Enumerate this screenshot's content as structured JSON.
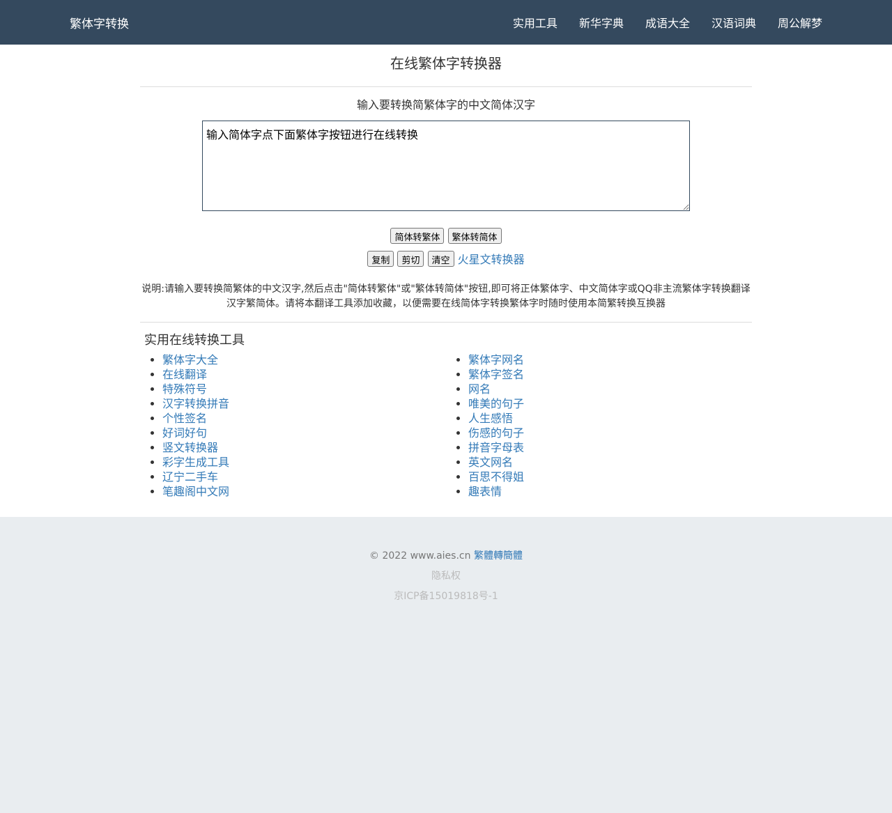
{
  "navbar": {
    "brand": "繁体字转换",
    "items": [
      "实用工具",
      "新华字典",
      "成语大全",
      "汉语词典",
      "周公解梦"
    ]
  },
  "main": {
    "title": "在线繁体字转换器",
    "subtitle": "输入要转换简繁体字的中文简体汉字",
    "textarea_value": "输入简体字点下面繁体字按钮进行在线转换",
    "buttons": {
      "to_traditional": "简体转繁体",
      "to_simplified": "繁体转简体",
      "copy": "复制",
      "cut": "剪切",
      "clear": "清空"
    },
    "martian_link": "火星文转换器",
    "description": "说明:请输入要转换简繁体的中文汉字,然后点击\"简体转繁体\"或\"繁体转简体\"按钮,即可将正体繁体字、中文简体字或QQ非主流繁体字转换翻译汉字繁简体。请将本翻译工具添加收藏，以便需要在线简体字转换繁体字时随时使用本简繁转换互换器"
  },
  "tools": {
    "title": "实用在线转换工具",
    "left": [
      "繁体字大全",
      "在线翻译",
      "特殊符号",
      "汉字转换拼音",
      "个性签名",
      "好词好句",
      "竖文转换器",
      "彩字生成工具",
      "辽宁二手车",
      "笔趣阁中文网"
    ],
    "right": [
      "繁体字网名",
      "繁体字签名",
      "网名",
      "唯美的句子",
      "人生感悟",
      "伤感的句子",
      "拼音字母表",
      "英文网名",
      "百思不得姐",
      "趣表情"
    ]
  },
  "footer": {
    "copyright": "© 2022 www.aies.cn",
    "copyright_link": "繁體轉簡體",
    "privacy": "隐私权",
    "icp": "京ICP备15019818号-1"
  },
  "colors": {
    "navbar_bg": "#34495e",
    "link": "#337ab7",
    "footer_bg": "#e9edf0"
  }
}
